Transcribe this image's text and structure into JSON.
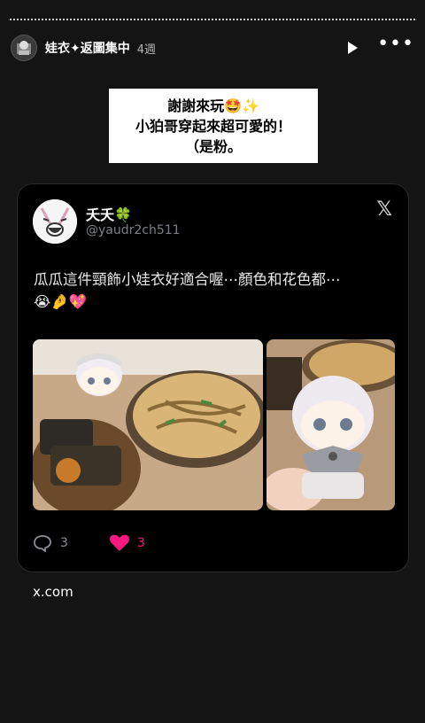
{
  "story": {
    "username": "娃衣✦返圖集中",
    "time": "4週",
    "avatar_icon": "doll-avatar"
  },
  "note": {
    "line1": "謝謝來玩🤩✨",
    "line2": "小狛哥穿起來超可愛的！",
    "line3": "（是粉。"
  },
  "tweet": {
    "display_name": "夭夭🍀",
    "handle": "@yaudr2ch511",
    "text_line1": "瓜瓜這件頸飾小娃衣好適合喔⋯顏色和花色都⋯",
    "text_line2": "😭🤌💖",
    "reply_count": "3",
    "like_count": "3",
    "like_color": "#f91880"
  },
  "link": {
    "source": "x.com"
  }
}
